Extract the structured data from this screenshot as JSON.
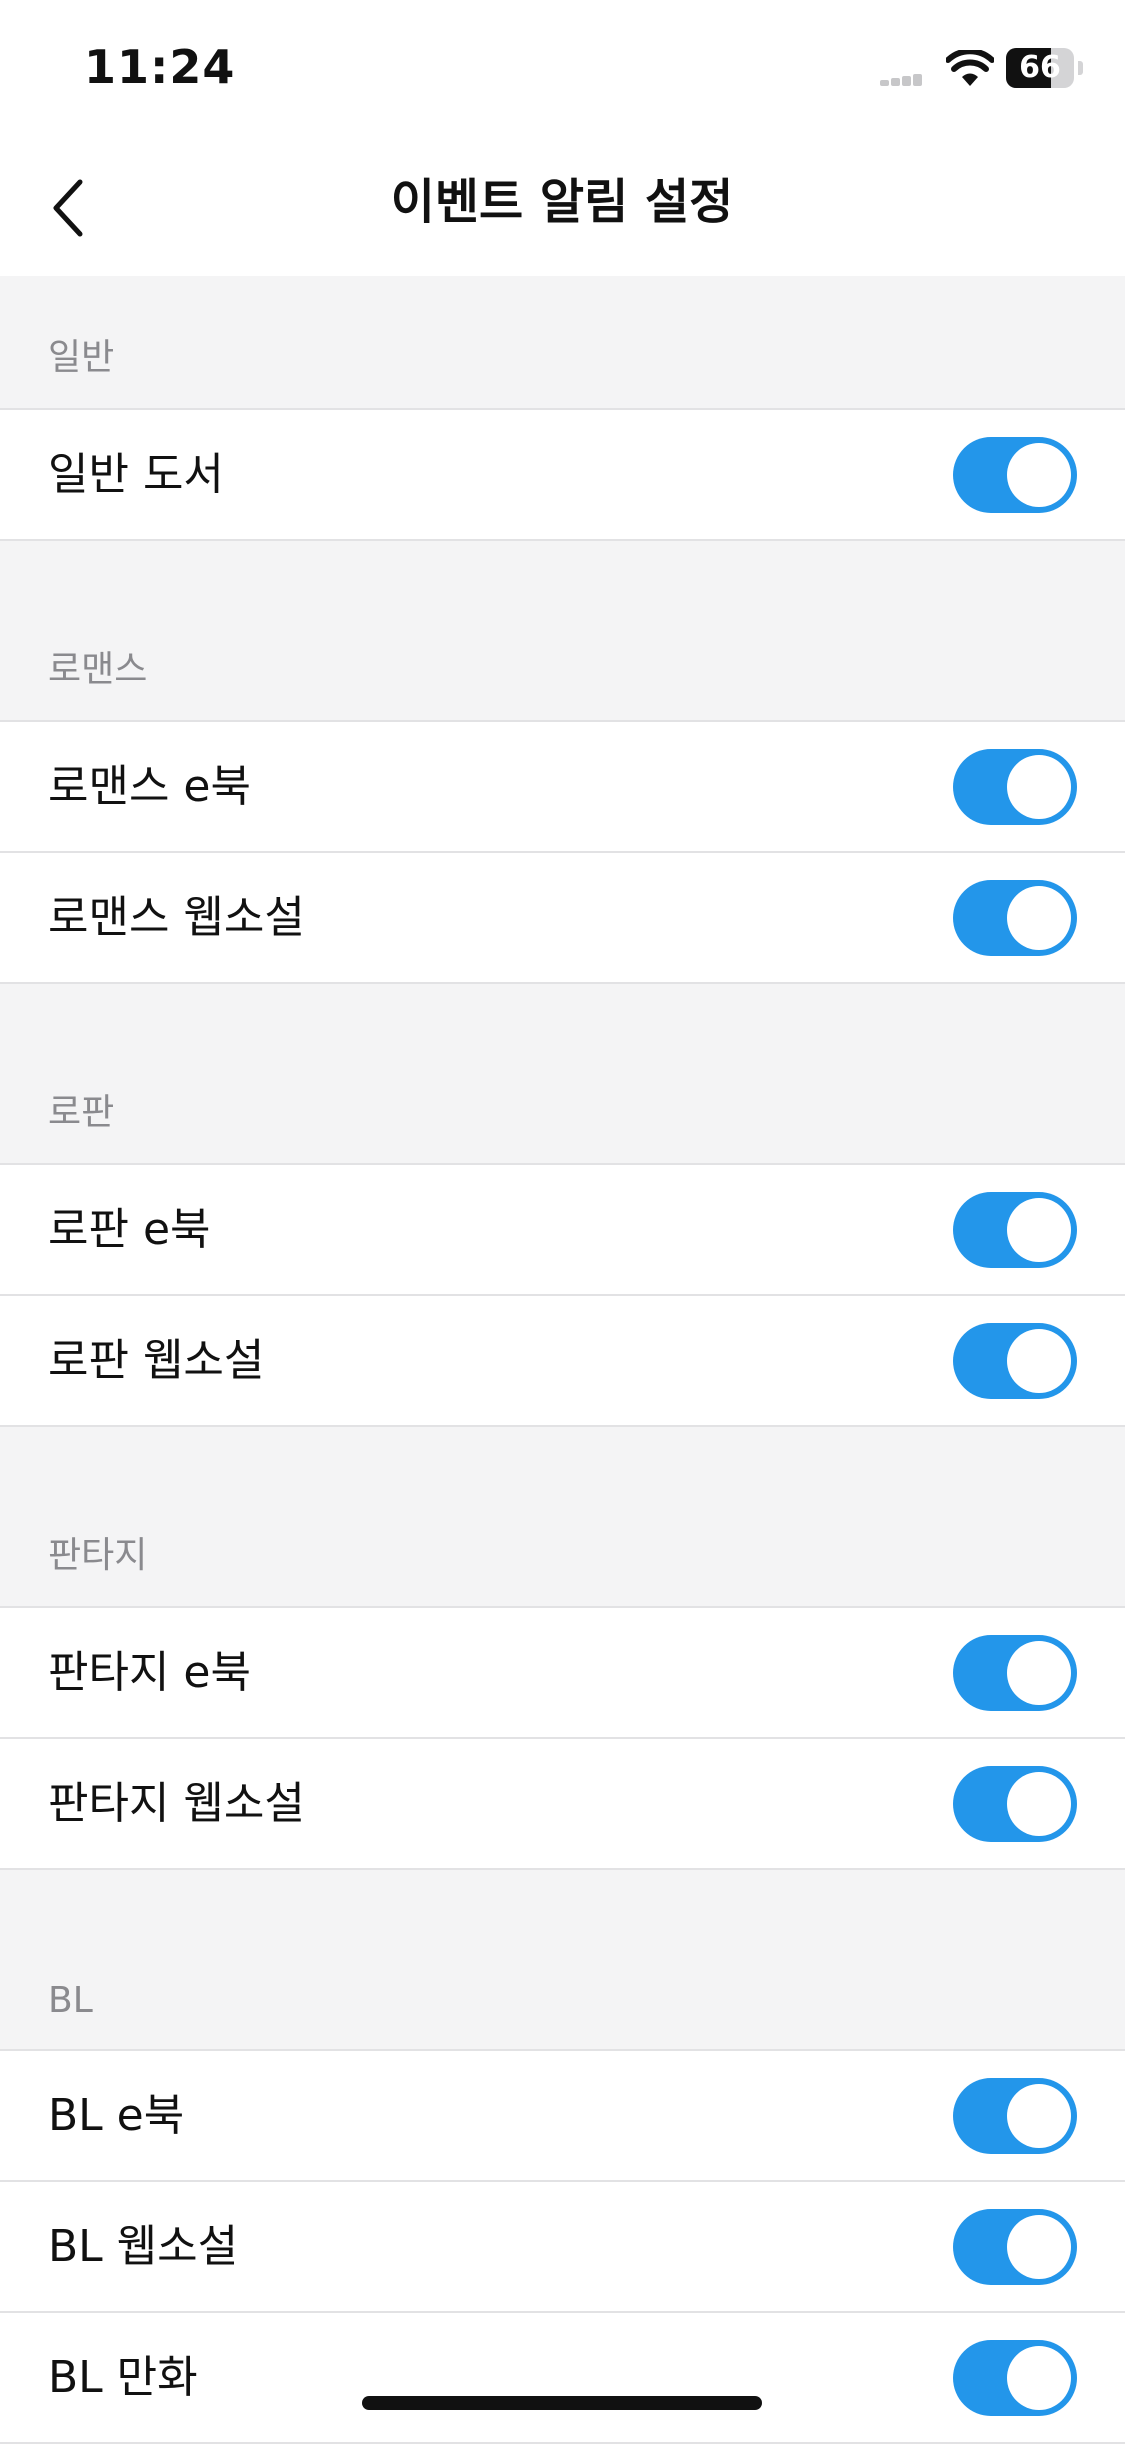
{
  "status_bar": {
    "time": "11:24",
    "battery_percent": "66",
    "battery_level": 0.66,
    "icons": [
      "signal-icon",
      "wifi-icon",
      "battery-icon"
    ]
  },
  "nav": {
    "title": "이벤트 알림 설정",
    "back_icon": "chevron-left-icon"
  },
  "colors": {
    "toggle_on": "#2396ea",
    "section_background": "#f4f4f5",
    "section_header_text": "#8a8a8e"
  },
  "sections": [
    {
      "header": "일반",
      "items": [
        {
          "label": "일반 도서",
          "enabled": true
        }
      ]
    },
    {
      "header": "로맨스",
      "items": [
        {
          "label": "로맨스 e북",
          "enabled": true
        },
        {
          "label": "로맨스 웹소설",
          "enabled": true
        }
      ]
    },
    {
      "header": "로판",
      "items": [
        {
          "label": "로판 e북",
          "enabled": true
        },
        {
          "label": "로판 웹소설",
          "enabled": true
        }
      ]
    },
    {
      "header": "판타지",
      "items": [
        {
          "label": "판타지 e북",
          "enabled": true
        },
        {
          "label": "판타지 웹소설",
          "enabled": true
        }
      ]
    },
    {
      "header": "BL",
      "items": [
        {
          "label": "BL e북",
          "enabled": true
        },
        {
          "label": "BL 웹소설",
          "enabled": true
        },
        {
          "label": "BL 만화",
          "enabled": true
        }
      ]
    }
  ]
}
